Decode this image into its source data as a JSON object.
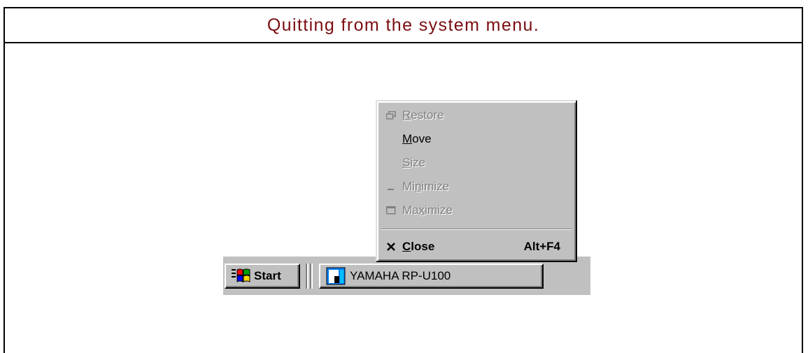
{
  "header": {
    "title": "Quitting from the system menu."
  },
  "menu": {
    "items": [
      {
        "pre": "",
        "u": "R",
        "post": "estore",
        "icon": "restore-icon",
        "enabled": false
      },
      {
        "pre": "",
        "u": "M",
        "post": "ove",
        "icon": "",
        "enabled": true
      },
      {
        "pre": "",
        "u": "S",
        "post": "ize",
        "icon": "",
        "enabled": false
      },
      {
        "pre": "Mi",
        "u": "n",
        "post": "imize",
        "icon": "minimize-icon",
        "enabled": false
      },
      {
        "pre": "Ma",
        "u": "x",
        "post": "imize",
        "icon": "maximize-icon",
        "enabled": false
      }
    ],
    "close": {
      "pre": "",
      "u": "C",
      "post": "lose",
      "icon": "close-x-icon",
      "accelerator": "Alt+F4"
    }
  },
  "taskbar": {
    "start_label": "Start",
    "task_label": "YAMAHA RP-U100"
  },
  "colors": {
    "title": "#7a0d10",
    "face": "#c0c0c0",
    "disabled_text": "#808080"
  }
}
